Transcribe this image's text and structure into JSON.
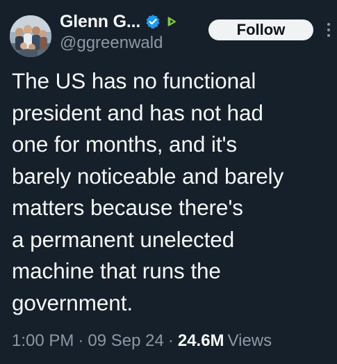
{
  "author": {
    "display_name": "Glenn G...",
    "handle": "@ggreenwald",
    "verified_icon": "verified-badge-icon",
    "affiliate_icon": "rumble-affiliate-icon"
  },
  "actions": {
    "follow_label": "Follow",
    "more_icon": "more-options-icon"
  },
  "tweet": {
    "text": "The US has no functional\npresident and has not had\none for months, and it's\nbarely noticeable and barely\nmatters because there's\na permanent unelected\nmachine that runs the\ngovernment."
  },
  "meta": {
    "time": "1:00 PM",
    "separator": "·",
    "date": "09 Sep 24",
    "views_count": "24.6M",
    "views_label": "Views"
  },
  "colors": {
    "background": "#15202b",
    "text_primary": "#f7f9f9",
    "text_secondary": "#8b98a5",
    "verified_blue": "#1d9bf0",
    "affiliate_green": "#85c742",
    "follow_bg": "#eff3f4"
  }
}
